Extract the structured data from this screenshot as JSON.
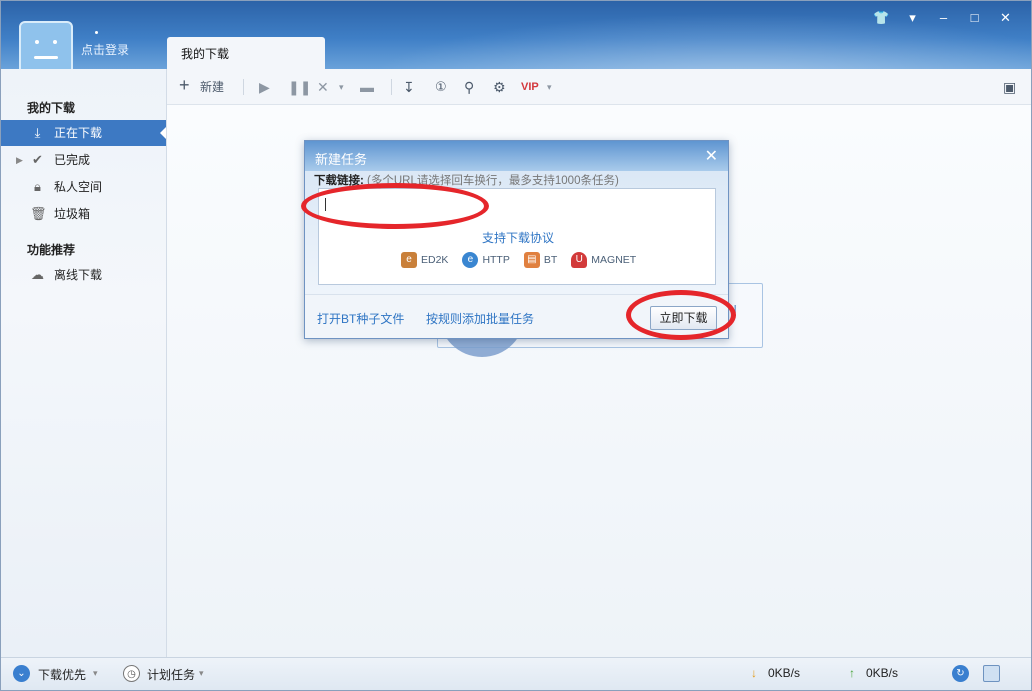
{
  "header": {
    "login_label": "点击登录",
    "tab_label": "我的下载",
    "window_buttons": [
      "skin-icon",
      "menu-icon",
      "minimize-icon",
      "maximize-icon",
      "close-icon"
    ]
  },
  "sidebar": {
    "section1_title": "我的下载",
    "items": [
      {
        "label": "正在下载",
        "icon": "download-icon"
      },
      {
        "label": "已完成",
        "icon": "check-icon"
      },
      {
        "label": "私人空间",
        "icon": "lock-icon"
      },
      {
        "label": "垃圾箱",
        "icon": "trash-icon"
      }
    ],
    "section2_title": "功能推荐",
    "feature_items": [
      {
        "label": "离线下载",
        "icon": "cloud-icon"
      }
    ]
  },
  "toolbar": {
    "new_label": "新建"
  },
  "dialog": {
    "title": "新建任务",
    "link_label": "下载链接:",
    "link_hint": "(多个URL请选择回车换行，最多支持1000条任务)",
    "url_value": "",
    "protocols_title": "支持下载协议",
    "protocols": [
      "ED2K",
      "HTTP",
      "BT",
      "MAGNET"
    ],
    "open_bt_link": "打开BT种子文件",
    "batch_link": "按规则添加批量任务",
    "download_button": "立即下载"
  },
  "statusbar": {
    "priority_label": "下载优先",
    "schedule_label": "计划任务",
    "down_speed": "0KB/s",
    "up_speed": "0KB/s"
  },
  "colors": {
    "accent": "#3d79c3",
    "annotation": "#e5262b"
  }
}
